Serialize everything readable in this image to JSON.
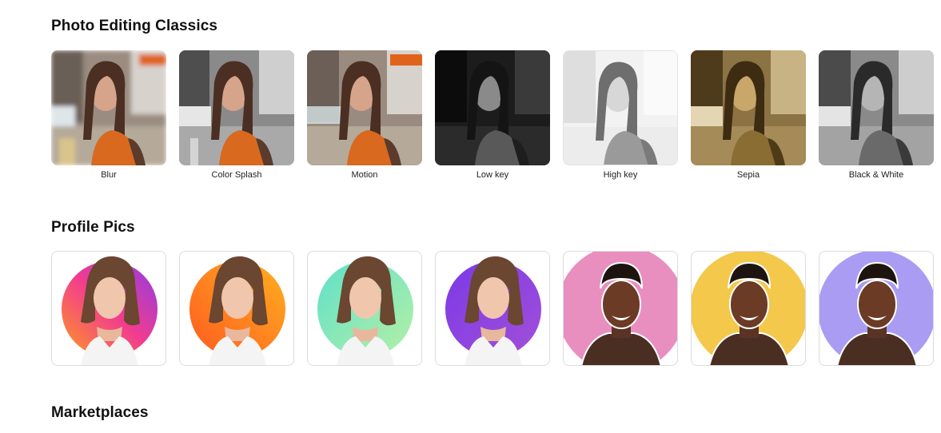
{
  "sections": {
    "classics": {
      "title": "Photo Editing Classics",
      "items": [
        {
          "label": "Blur",
          "filter": "blur"
        },
        {
          "label": "Color Splash",
          "filter": "splash"
        },
        {
          "label": "Motion",
          "filter": "motion"
        },
        {
          "label": "Low key",
          "filter": "lowkey"
        },
        {
          "label": "High key",
          "filter": "highkey"
        },
        {
          "label": "Sepia",
          "filter": "sepia"
        },
        {
          "label": "Black & White",
          "filter": "bw"
        }
      ]
    },
    "profile": {
      "title": "Profile Pics",
      "items": [
        {
          "style": "gradient-magenta",
          "subject": "woman"
        },
        {
          "style": "gradient-orange",
          "subject": "woman"
        },
        {
          "style": "gradient-mint",
          "subject": "woman"
        },
        {
          "style": "gradient-purple",
          "subject": "woman"
        },
        {
          "style": "pink",
          "subject": "man"
        },
        {
          "style": "yellow",
          "subject": "man"
        },
        {
          "style": "lavender",
          "subject": "man"
        }
      ]
    },
    "marketplaces": {
      "title": "Marketplaces"
    }
  },
  "colors": {
    "pink": "#e88fc0",
    "yellow": "#f3c84b",
    "lavender": "#a99cf2",
    "shirt_orange": "#d8691f"
  }
}
